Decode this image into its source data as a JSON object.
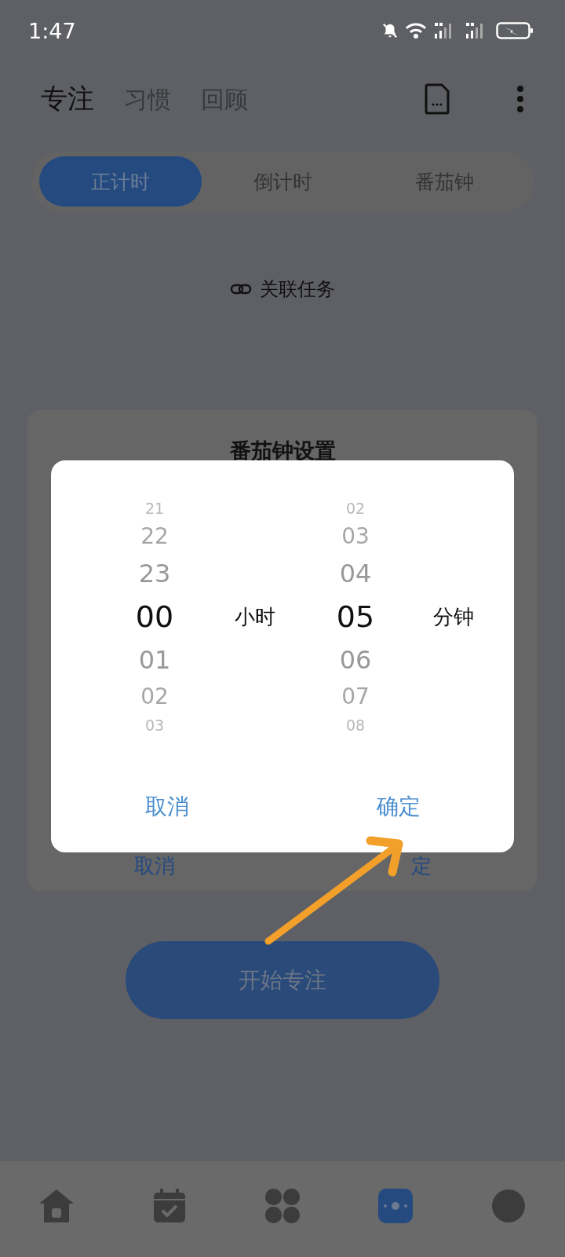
{
  "status_bar": {
    "time": "1:47"
  },
  "header": {
    "tabs": [
      {
        "label": "专注",
        "selected": true
      },
      {
        "label": "习惯",
        "selected": false
      },
      {
        "label": "回顾",
        "selected": false
      }
    ]
  },
  "mode_tabs": [
    {
      "label": "正计时",
      "selected": true
    },
    {
      "label": "倒计时",
      "selected": false
    },
    {
      "label": "番茄钟",
      "selected": false
    }
  ],
  "link_task": "关联任务",
  "settings_card": {
    "title": "番茄钟设置",
    "cancel": "取消",
    "confirm": "定"
  },
  "dialog": {
    "columns": [
      {
        "unit": "小时",
        "values": [
          {
            "value": "21",
            "selected": false
          },
          {
            "value": "22",
            "selected": false
          },
          {
            "value": "23",
            "selected": false
          },
          {
            "value": "00",
            "selected": true
          },
          {
            "value": "01",
            "selected": false
          },
          {
            "value": "02",
            "selected": false
          },
          {
            "value": "03",
            "selected": false
          }
        ]
      },
      {
        "unit": "分钟",
        "values": [
          {
            "value": "02",
            "selected": false
          },
          {
            "value": "03",
            "selected": false
          },
          {
            "value": "04",
            "selected": false
          },
          {
            "value": "05",
            "selected": true
          },
          {
            "value": "06",
            "selected": false
          },
          {
            "value": "07",
            "selected": false
          },
          {
            "value": "08",
            "selected": false
          }
        ]
      }
    ],
    "cancel": "取消",
    "confirm": "确定"
  },
  "start_button": "开始专注",
  "bottom_nav": [
    {
      "kind": "home",
      "selected": false
    },
    {
      "kind": "calendar",
      "selected": false
    },
    {
      "kind": "apps",
      "selected": false
    },
    {
      "kind": "focus",
      "selected": true
    },
    {
      "kind": "profile",
      "selected": false
    }
  ],
  "annotation": {
    "kind": "arrow"
  }
}
